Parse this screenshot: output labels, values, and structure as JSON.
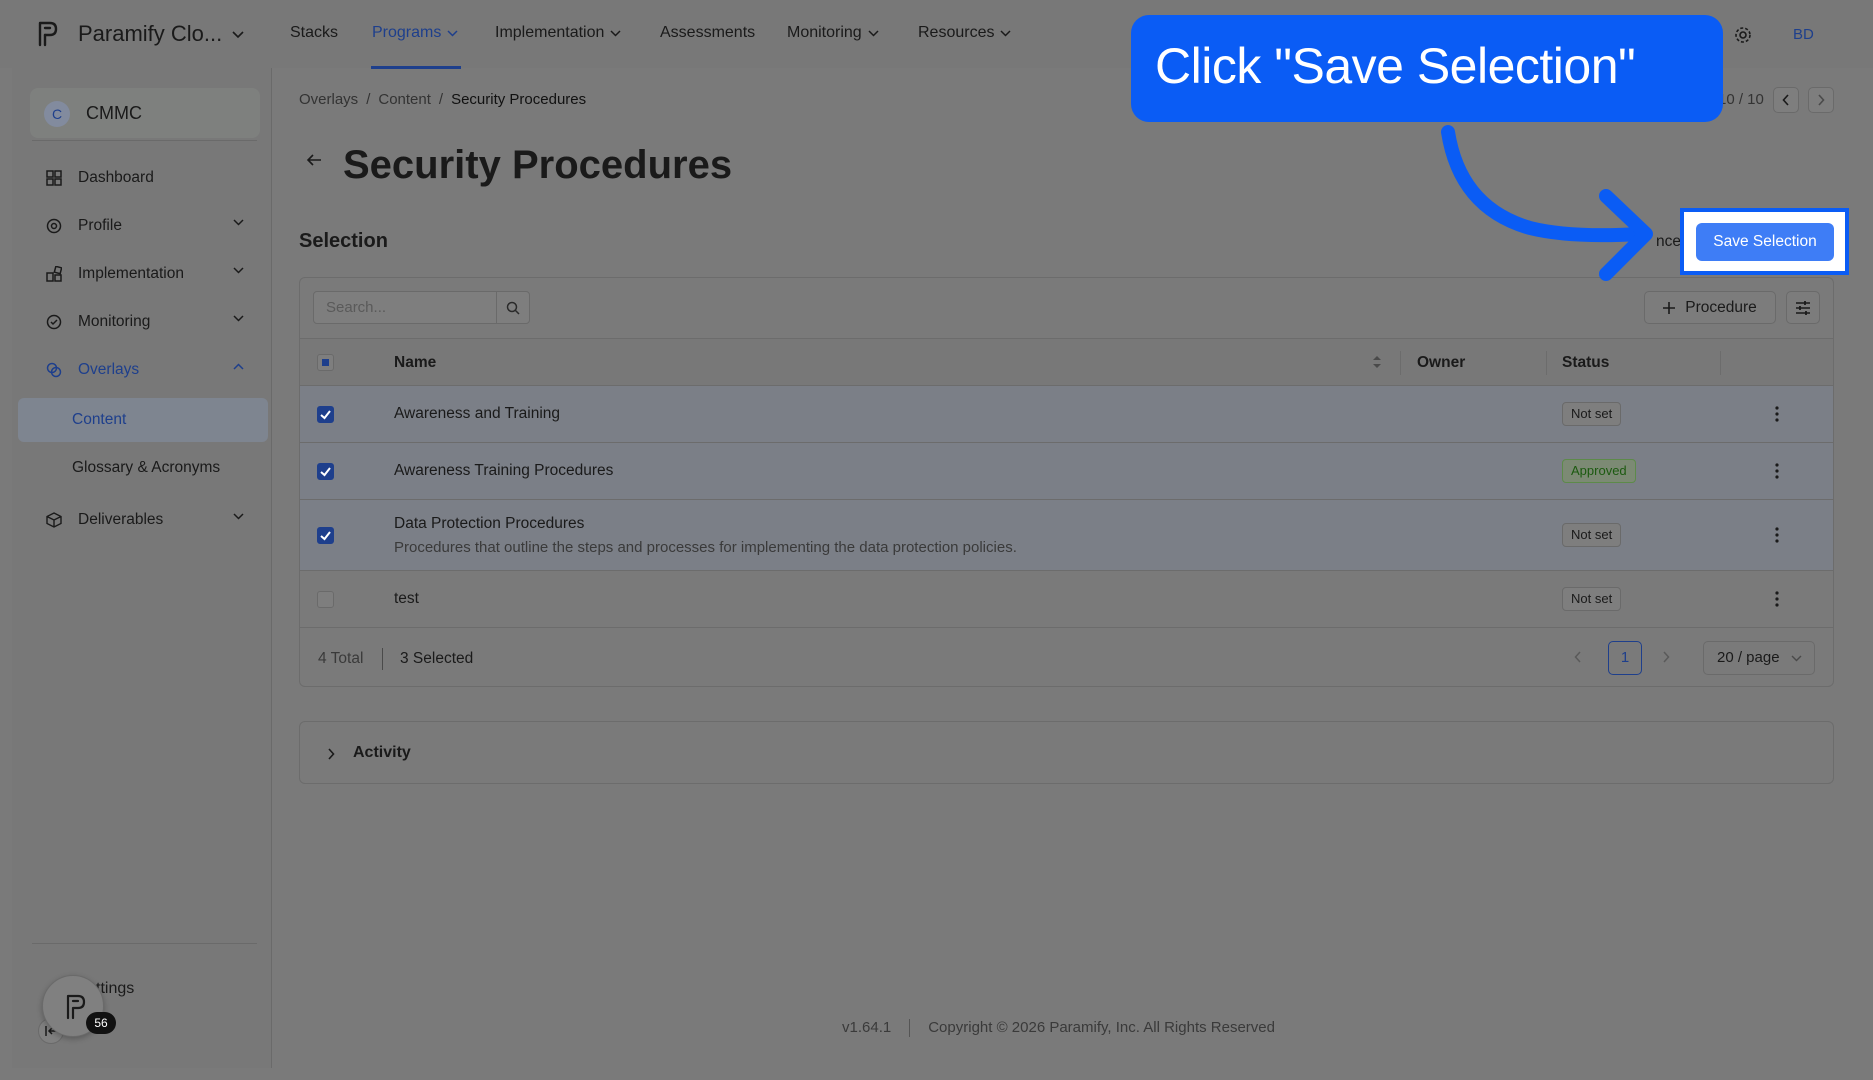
{
  "app": {
    "name": "Paramify Clo...",
    "avatar": "BD",
    "version": "v1.64.1",
    "copyright": "Copyright © 2026 Paramify, Inc. All Rights Reserved"
  },
  "topnav": [
    {
      "label": "Stacks",
      "dropdown": false,
      "active": false
    },
    {
      "label": "Programs",
      "dropdown": true,
      "active": true
    },
    {
      "label": "Implementation",
      "dropdown": true,
      "active": false
    },
    {
      "label": "Assessments",
      "dropdown": false,
      "active": false
    },
    {
      "label": "Monitoring",
      "dropdown": true,
      "active": false
    },
    {
      "label": "Resources",
      "dropdown": true,
      "active": false
    }
  ],
  "sidebar": {
    "program_badge": "C",
    "program_name": "CMMC",
    "items": [
      {
        "label": "Dashboard",
        "icon": "dashboard-icon"
      },
      {
        "label": "Profile",
        "icon": "profile-icon"
      },
      {
        "label": "Implementation",
        "icon": "implementation-icon"
      },
      {
        "label": "Monitoring",
        "icon": "monitoring-icon"
      },
      {
        "label": "Overlays",
        "icon": "overlays-icon"
      },
      {
        "label": "Content"
      },
      {
        "label": "Glossary & Acronyms"
      },
      {
        "label": "Deliverables",
        "icon": "deliverables-icon"
      }
    ],
    "settings_label": "ttings",
    "fab_badge": "56"
  },
  "breadcrumb": [
    "Overlays",
    "Content",
    "Security Procedures"
  ],
  "record_pager": "10 / 10",
  "page_title": "Security Procedures",
  "section_title": "Selection",
  "cancel_label": "ncel",
  "save_label": "Save Selection",
  "search_placeholder": "Search...",
  "add_button_label": "Procedure",
  "table": {
    "headers": {
      "name": "Name",
      "owner": "Owner",
      "status": "Status"
    },
    "rows": [
      {
        "name": "Awareness and Training",
        "desc": "",
        "status": "Not set",
        "checked": true
      },
      {
        "name": "Awareness Training Procedures",
        "desc": "",
        "status": "Approved",
        "checked": true
      },
      {
        "name": "Data Protection Procedures",
        "desc": "Procedures that outline the steps and processes for implementing the data protection policies.",
        "status": "Not set",
        "checked": true
      },
      {
        "name": "test",
        "desc": "",
        "status": "Not set",
        "checked": false
      }
    ]
  },
  "footer_bar": {
    "total": "4 Total",
    "selected": "3 Selected",
    "page": "1",
    "page_size": "20 / page"
  },
  "activity_label": "Activity",
  "callout": {
    "text": "Click \"Save Selection\"",
    "color": "#0a5cf5"
  }
}
